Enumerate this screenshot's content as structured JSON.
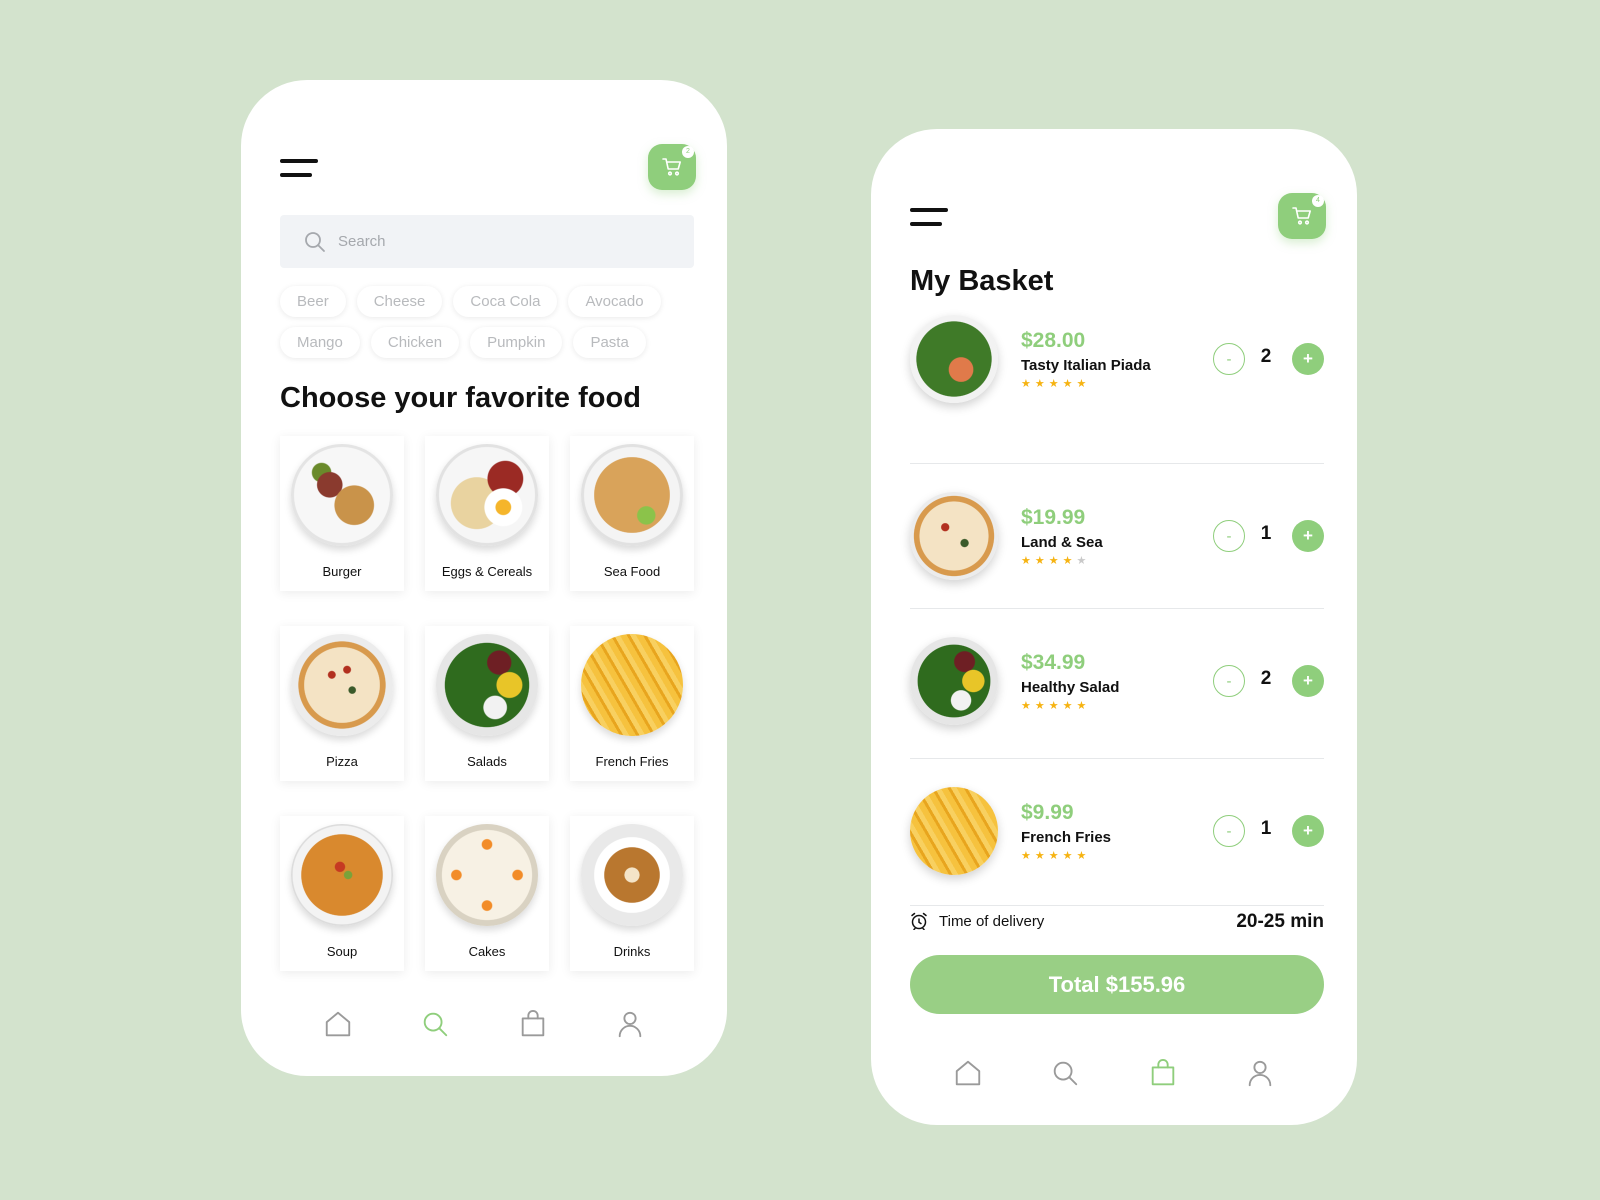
{
  "colors": {
    "background": "#d3e3cd",
    "accent": "#8fce7c",
    "total_button": "#99cf85",
    "star": "#f6b312",
    "star_empty": "#c9c9c9",
    "card": "#ffffff"
  },
  "left_screen": {
    "cart_badge": "2",
    "search": {
      "placeholder": "Search"
    },
    "chips_row1": [
      "Beer",
      "Cheese",
      "Coca Cola",
      "Avocado"
    ],
    "chips_row2": [
      "Mango",
      "Chicken",
      "Pumpkin",
      "Pasta"
    ],
    "section_title": "Choose your favorite food",
    "categories": [
      {
        "label": "Burger",
        "icon": "burger-plate-image"
      },
      {
        "label": "Eggs & Cereals",
        "icon": "eggs-cereals-plate-image"
      },
      {
        "label": "Sea Food",
        "icon": "sea-food-plate-image"
      },
      {
        "label": "Pizza",
        "icon": "pizza-image"
      },
      {
        "label": "Salads",
        "icon": "salad-plate-image"
      },
      {
        "label": "French Fries",
        "icon": "french-fries-image"
      },
      {
        "label": "Soup",
        "icon": "soup-bowl-image"
      },
      {
        "label": "Cakes",
        "icon": "cake-image"
      },
      {
        "label": "Drinks",
        "icon": "coffee-cup-image"
      }
    ],
    "nav": [
      {
        "name": "home",
        "icon": "home-icon",
        "active": false
      },
      {
        "name": "search",
        "icon": "search-icon",
        "active": true
      },
      {
        "name": "bag",
        "icon": "bag-icon",
        "active": false
      },
      {
        "name": "profile",
        "icon": "user-icon",
        "active": false
      }
    ]
  },
  "right_screen": {
    "cart_badge": "4",
    "title": "My Basket",
    "items": [
      {
        "price": "$28.00",
        "name": "Tasty Italian Piada",
        "rating": 5,
        "quantity": "2",
        "minus_label": "-",
        "plus_label": "+"
      },
      {
        "price": "$19.99",
        "name": "Land & Sea",
        "rating": 4,
        "quantity": "1",
        "minus_label": "-",
        "plus_label": "+"
      },
      {
        "price": "$34.99",
        "name": "Healthy Salad",
        "rating": 5,
        "quantity": "2",
        "minus_label": "-",
        "plus_label": "+"
      },
      {
        "price": "$9.99",
        "name": "French Fries",
        "rating": 5,
        "quantity": "1",
        "minus_label": "-",
        "plus_label": "+"
      }
    ],
    "delivery_label": "Time of delivery",
    "delivery_value": "20-25 min",
    "total_label": "Total $155.96",
    "nav": [
      {
        "name": "home",
        "icon": "home-icon",
        "active": false
      },
      {
        "name": "search",
        "icon": "search-icon",
        "active": false
      },
      {
        "name": "bag",
        "icon": "bag-icon",
        "active": true
      },
      {
        "name": "profile",
        "icon": "user-icon",
        "active": false
      }
    ]
  }
}
